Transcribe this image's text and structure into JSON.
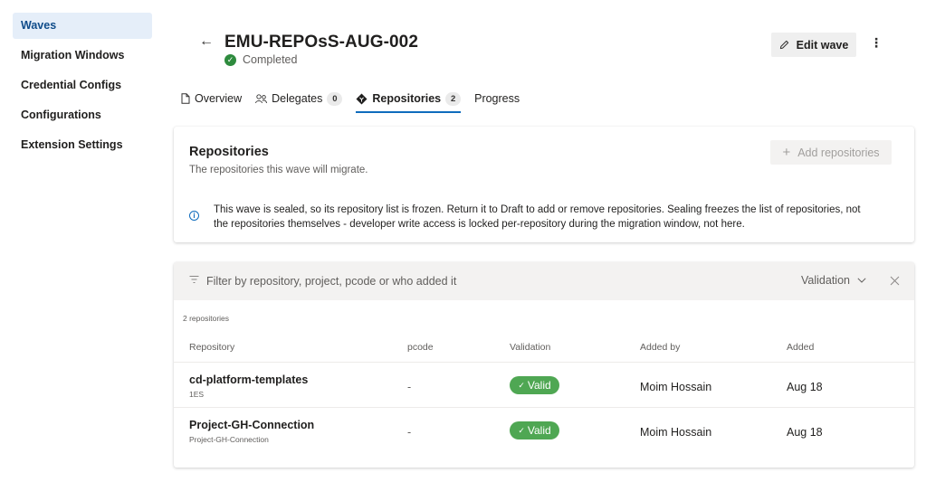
{
  "sidebar": {
    "items": [
      {
        "label": "Waves",
        "active": true
      },
      {
        "label": "Migration Windows"
      },
      {
        "label": "Credential Configs"
      },
      {
        "label": "Configurations"
      },
      {
        "label": "Extension Settings"
      }
    ]
  },
  "header": {
    "title": "EMU-REPOsS-AUG-002",
    "status": "Completed",
    "edit_label": "Edit wave",
    "more_label": "⋮"
  },
  "tabs": [
    {
      "label": "Overview",
      "icon": "document-icon"
    },
    {
      "label": "Delegates",
      "icon": "people-icon",
      "count": "0"
    },
    {
      "label": "Repositories",
      "icon": "repo-diamond-icon",
      "count": "2",
      "active": true
    },
    {
      "label": "Progress"
    }
  ],
  "repos_card": {
    "title": "Repositories",
    "subtitle": "The repositories this wave will migrate.",
    "add_label": "Add repositories",
    "info_line1": "This wave is sealed, so its repository list is frozen. Return it to Draft to add or remove repositories. Sealing freezes the list of repositories, not",
    "info_line2": "the repositories themselves - developer write access is locked per-repository during the migration window, not here."
  },
  "filter": {
    "placeholder": "Filter by repository, project, pcode or who added it",
    "validation_label": "Validation"
  },
  "table": {
    "count_label": "2 repositories",
    "columns": [
      "Repository",
      "pcode",
      "Validation",
      "Added by",
      "Added"
    ],
    "rows": [
      {
        "name": "cd-platform-templates",
        "project": "1ES",
        "pcode": "-",
        "validation": "Valid",
        "added_by": "Moim Hossain",
        "added": "Aug 18"
      },
      {
        "name": "Project-GH-Connection",
        "project": "Project-GH-Connection",
        "pcode": "-",
        "validation": "Valid",
        "added_by": "Moim Hossain",
        "added": "Aug 18"
      }
    ]
  },
  "colors": {
    "accent": "#0f6cbd",
    "valid_green": "#4fa753",
    "completed_green": "#2e8b3e",
    "active_nav_bg": "#e5eef9"
  }
}
